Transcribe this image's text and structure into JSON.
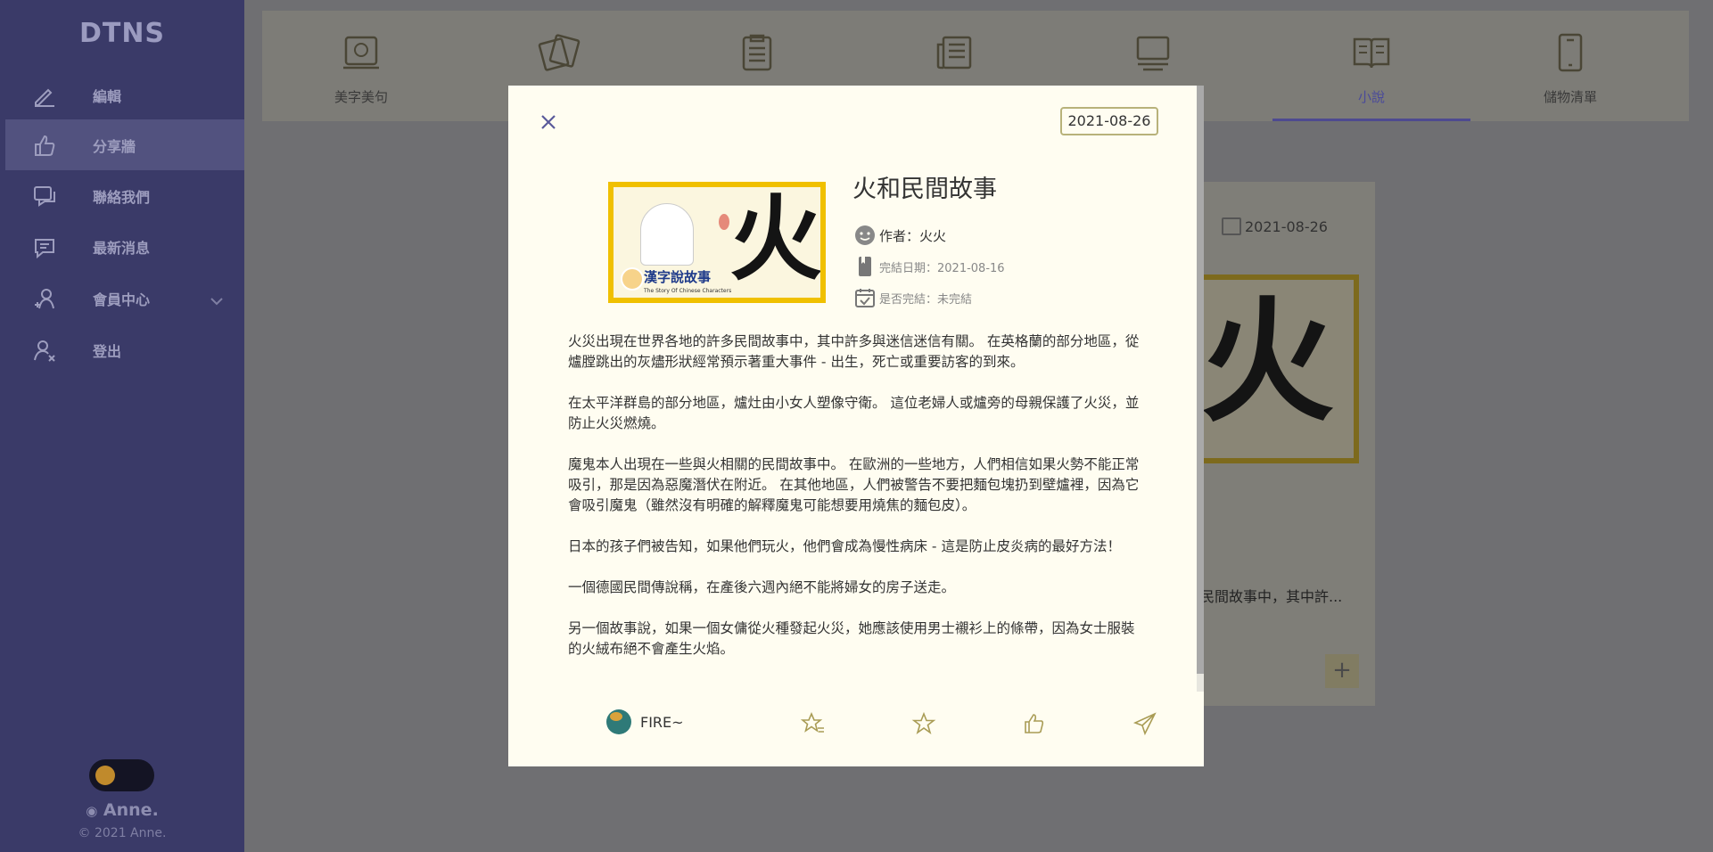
{
  "sidebar": {
    "logo": "DTNS",
    "items": [
      {
        "label": "編輯",
        "icon": "pencil-icon"
      },
      {
        "label": "分享牆",
        "icon": "thumb-up-icon"
      },
      {
        "label": "聯絡我們",
        "icon": "chat-icon"
      },
      {
        "label": "最新消息",
        "icon": "message-icon"
      },
      {
        "label": "會員中心",
        "icon": "user-plus-icon"
      },
      {
        "label": "登出",
        "icon": "user-x-icon"
      }
    ],
    "user": "Anne.",
    "copyright": "© 2021 Anne."
  },
  "tabs": [
    {
      "label": "美字美句",
      "icon": "frame-icon"
    },
    {
      "label": "",
      "icon": "cards-icon"
    },
    {
      "label": "",
      "icon": "clipboard-icon"
    },
    {
      "label": "",
      "icon": "newspaper-icon"
    },
    {
      "label": "",
      "icon": "screen-icon"
    },
    {
      "label": "小說",
      "icon": "book-open-icon"
    },
    {
      "label": "儲物清單",
      "icon": "phone-icon"
    }
  ],
  "card": {
    "date": "2021-08-26",
    "excerpt": "民間故事中，其中許...",
    "add_label": "+"
  },
  "modal": {
    "date": "2021-08-26",
    "title": "火和民間故事",
    "author": "作者：火火",
    "finish_date": "完結日期：2021-08-16",
    "status": "是否完結：未完結",
    "cover": {
      "glyph": "火",
      "brand": "漢字說故事",
      "brand_sub": "The Story Of Chinese Characters"
    },
    "paragraphs": [
      "火災出現在世界各地的許多民間故事中，其中許多與迷信迷信有關。 在英格蘭的部分地區，從爐膛跳出的灰燼形狀經常預示著重大事件 - 出生，死亡或重要訪客的到來。",
      "在太平洋群島的部分地區，爐灶由小女人塑像守衛。 這位老婦人或爐旁的母親保護了火災，並防止火災燃燒。",
      "魔鬼本人出現在一些與火相關的民間故事中。 在歐洲的一些地方，人們相信如果火勢不能正常吸引，那是因為惡魔潛伏在附近。 在其他地區，人們被警告不要把麵包塊扔到壁爐裡，因為它會吸引魔鬼（雖然沒有明確的解釋魔鬼可能想要用燒焦的麵包皮）。",
      "日本的孩子們被告知，如果他們玩火，他們會成為慢性病床 - 這是防止皮炎病的最好方法！",
      "一個德國民間傳說稱，在產後六週內絕不能將婦女的房子送走。",
      "另一個故事說，如果一個女傭從火種發起火災，她應該使用男士襯衫上的條帶，因為女士服裝的火絨布絕不會產生火焰。"
    ],
    "footer_user": "FIRE~"
  },
  "colors": {
    "sidebar": "#3a3a68",
    "modal_bg": "#fffdf1",
    "accent": "#4e4a90",
    "badge_border": "#b8b27a"
  }
}
